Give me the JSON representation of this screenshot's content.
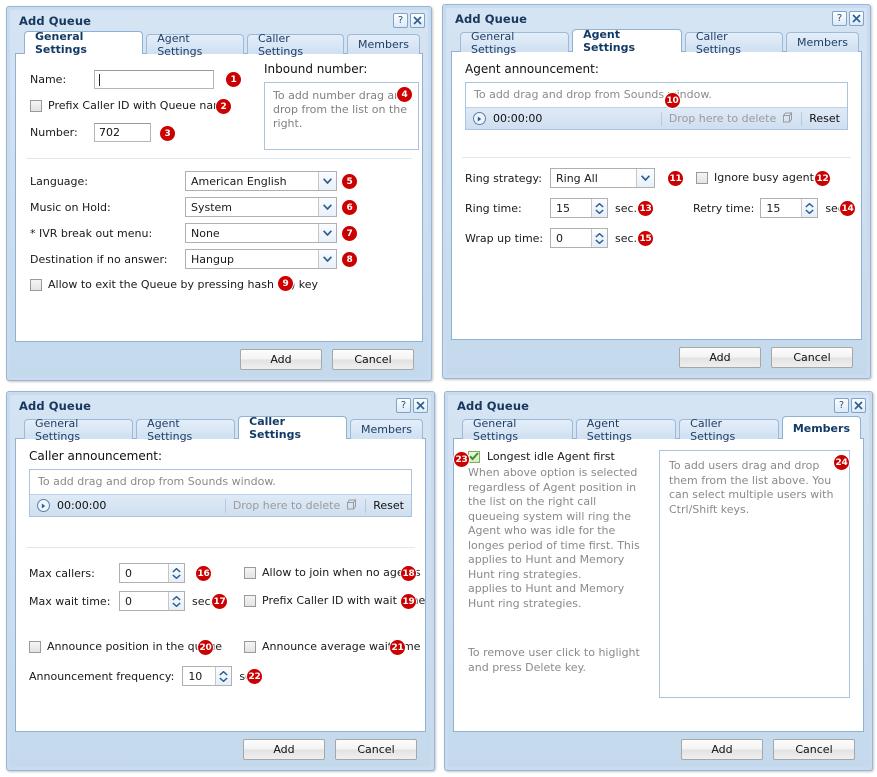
{
  "window": {
    "title": "Add Queue",
    "help_button": "?",
    "close_button": "✕"
  },
  "tabs": [
    "General Settings",
    "Agent Settings",
    "Caller Settings",
    "Members"
  ],
  "footer": {
    "add": "Add",
    "cancel": "Cancel"
  },
  "colors": {
    "badge": "#cc0000",
    "title_text": "#17375e",
    "dialog_bg": "#c9dcef",
    "panel_bg": "#ffffff"
  },
  "general_settings": {
    "active_tab": "General Settings",
    "name_label": "Name:",
    "name_value": "",
    "prefix_callerid_label": "Prefix Caller ID with Queue name",
    "prefix_callerid_checked": false,
    "number_label": "Number:",
    "number_value": "702",
    "inbound_label": "Inbound number:",
    "inbound_placeholder": "To add number drag and drop from the list on the right.",
    "language_label": "Language:",
    "language_value": "American English",
    "music_label": "Music on Hold:",
    "music_value": "System",
    "ivr_label": "* IVR break out menu:",
    "ivr_value": "None",
    "destination_label": "Destination if no answer:",
    "destination_value": "Hangup",
    "allow_exit_label": "Allow to exit the Queue by pressing hash (#) key",
    "allow_exit_checked": false,
    "badges": [
      "1",
      "2",
      "3",
      "4",
      "5",
      "6",
      "7",
      "8",
      "9"
    ]
  },
  "agent_settings": {
    "active_tab": "Agent Settings",
    "announcement_label": "Agent announcement:",
    "announcement_placeholder": "To add drag and drop from Sounds window.",
    "player_time": "00:00:00",
    "drop_delete_label": "Drop here to delete",
    "reset_label": "Reset",
    "ring_strategy_label": "Ring strategy:",
    "ring_strategy_value": "Ring All",
    "ignore_busy_label": "Ignore busy agents",
    "ignore_busy_checked": false,
    "ring_time_label": "Ring time:",
    "ring_time_value": "15",
    "ring_time_unit": "sec.",
    "retry_time_label": "Retry time:",
    "retry_time_value": "15",
    "retry_time_unit": "sec.",
    "wrap_up_label": "Wrap up time:",
    "wrap_up_value": "0",
    "wrap_up_unit": "sec.",
    "badges": [
      "10",
      "11",
      "12",
      "13",
      "14",
      "15"
    ]
  },
  "caller_settings": {
    "active_tab": "Caller Settings",
    "announcement_label": "Caller announcement:",
    "announcement_placeholder": "To add drag and drop from Sounds window.",
    "player_time": "00:00:00",
    "drop_delete_label": "Drop here to delete",
    "reset_label": "Reset",
    "max_callers_label": "Max callers:",
    "max_callers_value": "0",
    "max_wait_label": "Max wait time:",
    "max_wait_value": "0",
    "max_wait_unit": "sec.",
    "allow_join_label": "Allow to join when no agents",
    "allow_join_checked": false,
    "prefix_wait_label": "Prefix Caller ID with wait time",
    "prefix_wait_checked": false,
    "announce_position_label": "Announce position in the queue",
    "announce_position_checked": false,
    "announce_avg_label": "Announce average wait time",
    "announce_avg_checked": false,
    "frequency_label": "Announcement frequency:",
    "frequency_value": "10",
    "frequency_unit": "sec.",
    "badges": [
      "16",
      "17",
      "18",
      "19",
      "20",
      "21",
      "22"
    ]
  },
  "members": {
    "active_tab": "Members",
    "longest_idle_label": "Longest idle Agent first",
    "longest_idle_checked": true,
    "description": "When above option is selected regardless of Agent position in the list on the right call queueing system will ring the Agent who was idle for the longes period of time first. This applies to Hunt and Memory Hunt ring strategies.\napplies to Hunt and Memory Hunt ring strategies.",
    "remove_hint": "To remove user click to higlight and press Delete key.",
    "members_placeholder": "To add users drag and drop them from the list above. You can select multiple users with Ctrl/Shift keys.",
    "badges": [
      "23",
      "24"
    ]
  }
}
